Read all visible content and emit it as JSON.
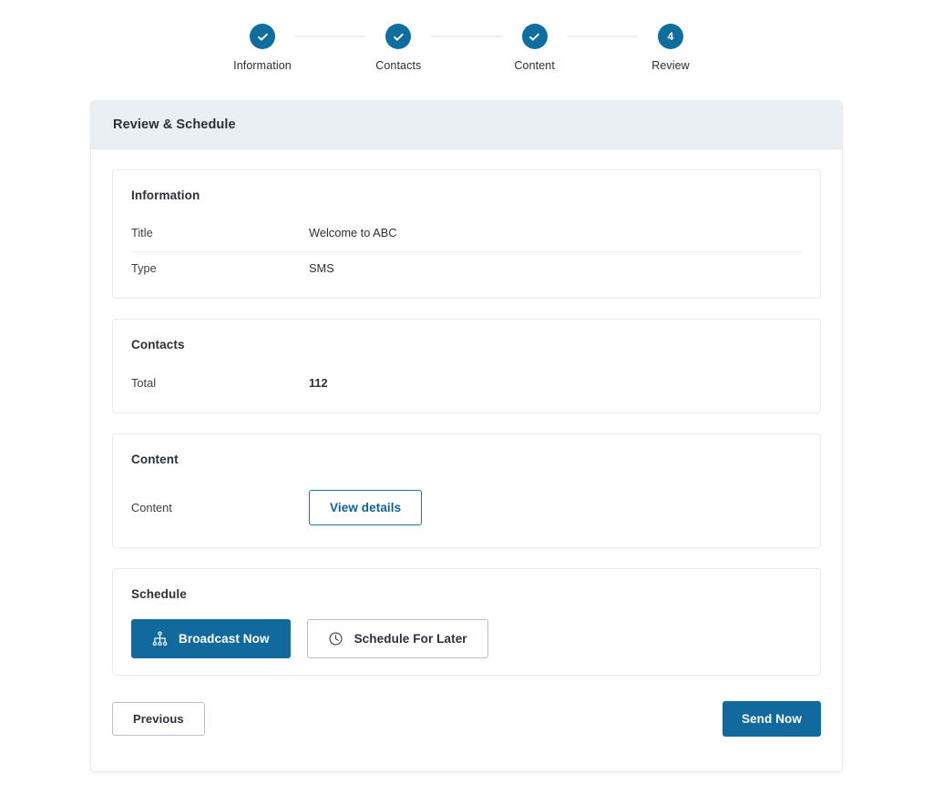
{
  "stepper": {
    "steps": [
      {
        "label": "Information",
        "state": "complete",
        "marker": "check"
      },
      {
        "label": "Contacts",
        "state": "complete",
        "marker": "check"
      },
      {
        "label": "Content",
        "state": "complete",
        "marker": "check"
      },
      {
        "label": "Review",
        "state": "active",
        "marker": "4"
      }
    ]
  },
  "panel": {
    "title": "Review & Schedule"
  },
  "sections": {
    "information": {
      "title": "Information",
      "rows": [
        {
          "label": "Title",
          "value": "Welcome to ABC"
        },
        {
          "label": "Type",
          "value": "SMS"
        }
      ]
    },
    "contacts": {
      "title": "Contacts",
      "rows": [
        {
          "label": "Total",
          "value": "112"
        }
      ]
    },
    "content": {
      "title": "Content",
      "label": "Content",
      "view_details_label": "View details"
    },
    "schedule": {
      "title": "Schedule",
      "broadcast_now_label": "Broadcast Now",
      "broadcast_now_icon": "sitemap-icon",
      "schedule_later_label": "Schedule For Later",
      "schedule_later_icon": "clock-icon"
    }
  },
  "footer": {
    "previous_label": "Previous",
    "send_now_label": "Send Now"
  },
  "colors": {
    "accent_blue": "#12699b",
    "step_blue": "#0f6e9e",
    "header_bg": "#e9eff2",
    "border": "#e8eaec"
  }
}
